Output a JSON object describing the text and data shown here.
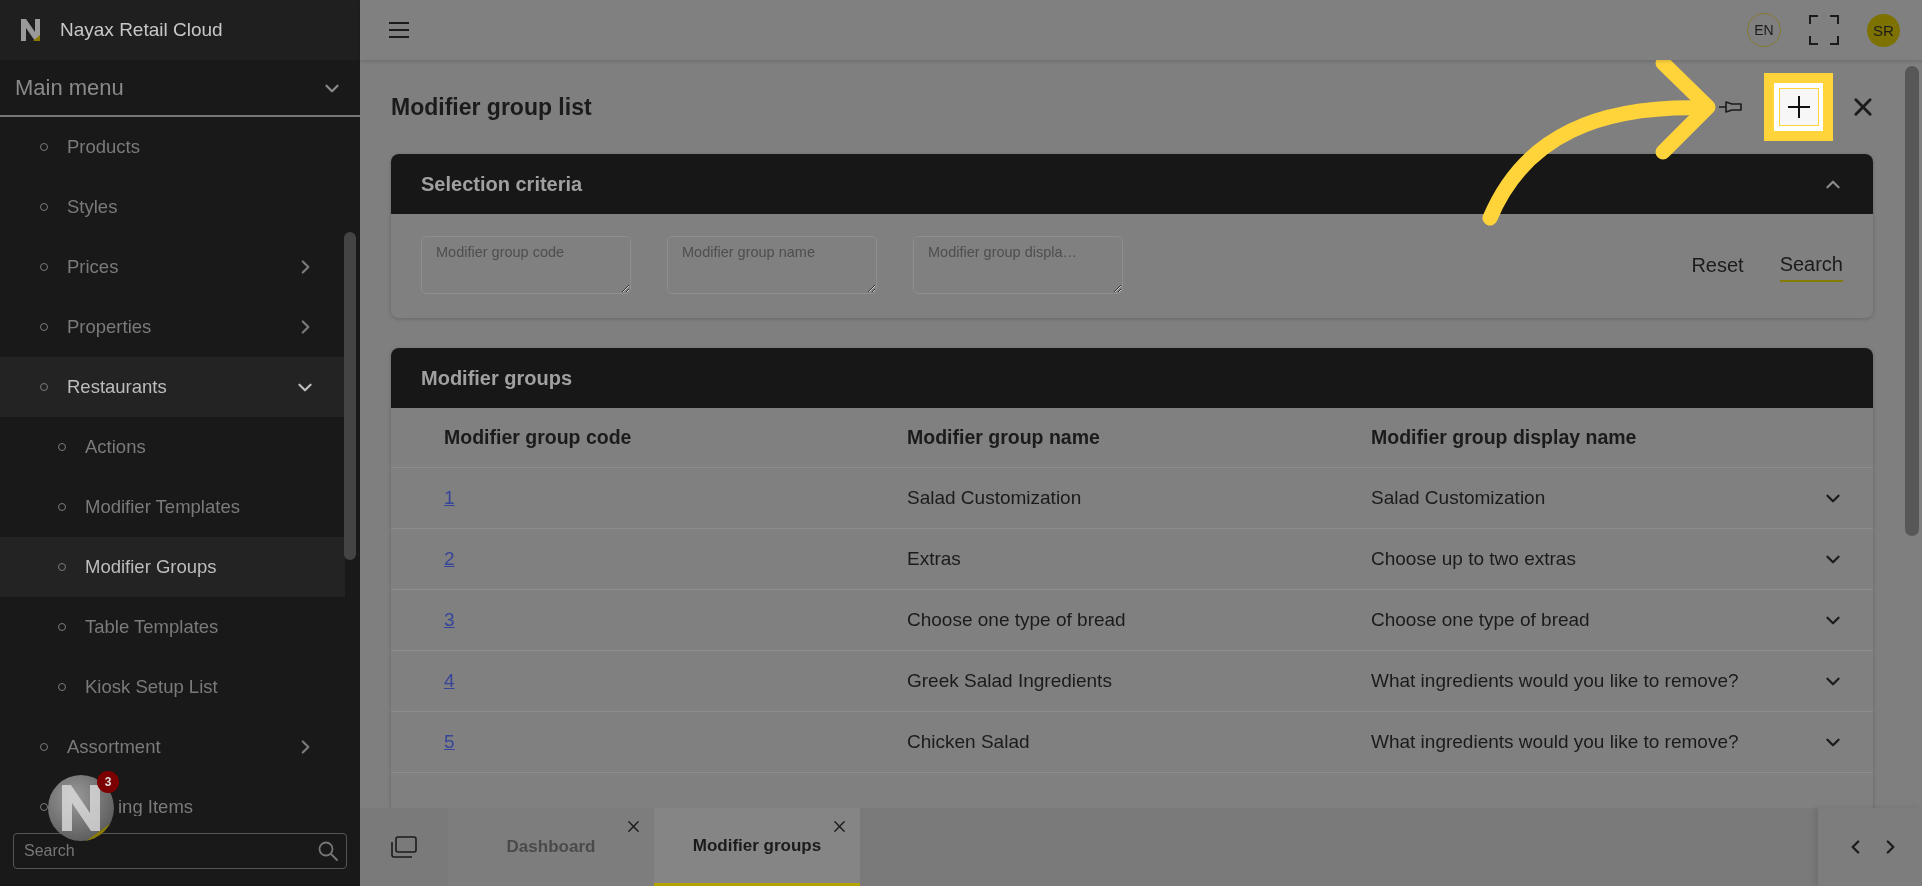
{
  "app": {
    "title": "Nayax Retail Cloud"
  },
  "sidebar": {
    "menu_title": "Main menu",
    "items": [
      {
        "label": "Products",
        "kind": "link",
        "selected": false
      },
      {
        "label": "Styles",
        "kind": "link",
        "selected": false
      },
      {
        "label": "Prices",
        "kind": "group",
        "expanded": false,
        "selected": false
      },
      {
        "label": "Properties",
        "kind": "group",
        "expanded": false,
        "selected": false
      },
      {
        "label": "Restaurants",
        "kind": "group",
        "expanded": true,
        "selected": true,
        "children": [
          {
            "label": "Actions",
            "kind": "link",
            "selected": false
          },
          {
            "label": "Modifier Templates",
            "kind": "link",
            "selected": false
          },
          {
            "label": "Modifier Groups",
            "kind": "link",
            "selected": true
          },
          {
            "label": "Table Templates",
            "kind": "link",
            "selected": false
          },
          {
            "label": "Kiosk Setup List",
            "kind": "link",
            "selected": false
          }
        ]
      },
      {
        "label": "Assortment",
        "kind": "group",
        "expanded": false,
        "selected": false
      },
      {
        "label": "ing Items",
        "kind": "partial",
        "selected": false
      }
    ],
    "search": {
      "placeholder": "Search"
    }
  },
  "chat_badge": {
    "count": "3"
  },
  "topbar": {
    "language": "EN",
    "user_initials": "SR"
  },
  "page": {
    "title": "Modifier group list"
  },
  "criteria": {
    "title": "Selection criteria",
    "expanded": true,
    "fields": [
      {
        "placeholder": "Modifier group code"
      },
      {
        "placeholder": "Modifier group name"
      },
      {
        "placeholder": "Modifier group displa…"
      }
    ],
    "buttons": [
      {
        "label": "Reset",
        "kind": "plain"
      },
      {
        "label": "Search",
        "kind": "primary"
      }
    ]
  },
  "table": {
    "title": "Modifier groups",
    "columns": [
      "Modifier group code",
      "Modifier group name",
      "Modifier group display name"
    ],
    "rows": [
      {
        "cells": [
          "1",
          "Salad Customization",
          "Salad Customization"
        ],
        "expanded": false
      },
      {
        "cells": [
          "2",
          "Extras",
          "Choose up to two extras"
        ],
        "expanded": false
      },
      {
        "cells": [
          "3",
          "Choose one type of bread",
          "Choose one type of bread"
        ],
        "expanded": false
      },
      {
        "cells": [
          "4",
          "Greek Salad Ingredients",
          "What ingredients would you like to remove?"
        ],
        "expanded": false
      },
      {
        "cells": [
          "5",
          "Chicken Salad",
          "What ingredients would you like to remove?"
        ],
        "expanded": false
      }
    ]
  },
  "tabs": [
    {
      "label": "Dashboard",
      "selected": false
    },
    {
      "label": "Modifier groups",
      "selected": true
    }
  ]
}
